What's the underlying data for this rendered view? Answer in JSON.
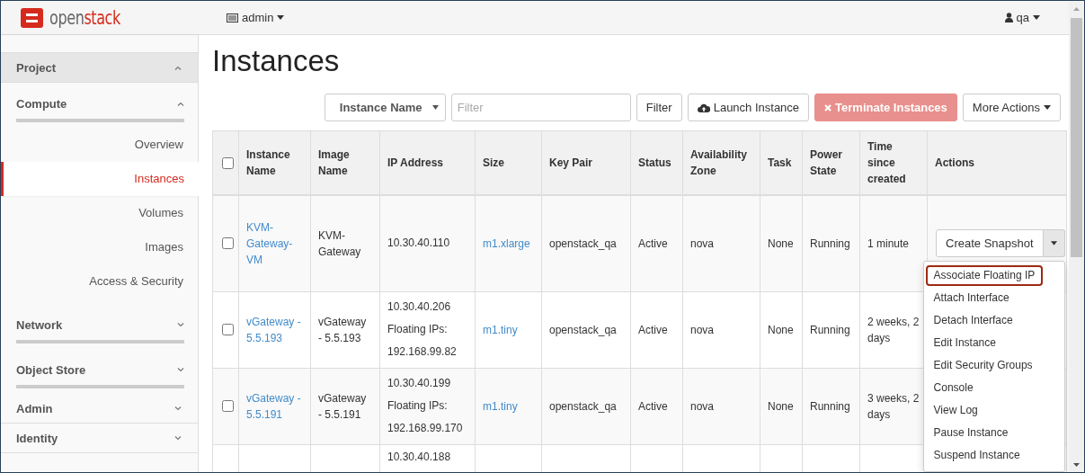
{
  "navbar": {
    "logo_text": [
      "open",
      "stack"
    ],
    "project": "admin",
    "user": "qa"
  },
  "sidebar": {
    "sections": [
      {
        "label": "Project",
        "expanded": true,
        "kind": "dashboard",
        "children": [
          {
            "label": "Compute",
            "expanded": true,
            "kind": "panel",
            "children": [
              {
                "label": "Overview",
                "selected": false
              },
              {
                "label": "Instances",
                "selected": true
              },
              {
                "label": "Volumes",
                "selected": false
              },
              {
                "label": "Images",
                "selected": false
              },
              {
                "label": "Access & Security",
                "selected": false
              }
            ]
          },
          {
            "label": "Network",
            "expanded": false,
            "kind": "panel"
          },
          {
            "label": "Object Store",
            "expanded": false,
            "kind": "panel"
          }
        ]
      },
      {
        "label": "Admin",
        "expanded": false,
        "kind": "dashboard"
      },
      {
        "label": "Identity",
        "expanded": false,
        "kind": "dashboard"
      }
    ]
  },
  "page": {
    "title": "Instances"
  },
  "toolbar": [
    {
      "kind": "select",
      "label": "Instance Name"
    },
    {
      "kind": "input",
      "placeholder": "Filter"
    },
    {
      "kind": "button",
      "label": "Filter"
    },
    {
      "kind": "cloud-button",
      "label": "Launch Instance"
    },
    {
      "kind": "danger-button",
      "label": "Terminate Instances"
    },
    {
      "kind": "dropdown-button",
      "label": "More Actions"
    }
  ],
  "table": {
    "select_all_checked": false,
    "columns": [
      "Instance Name",
      "Image Name",
      "IP Address",
      "Size",
      "Key Pair",
      "Status",
      "Availability Zone",
      "Task",
      "Power State",
      "Time since created",
      "Actions"
    ],
    "rows": [
      {
        "checked": false,
        "instance_name": "KVM-Gateway-VM",
        "image_name": "KVM-Gateway",
        "ip_address": [
          "10.30.40.110"
        ],
        "size": "m1.xlarge",
        "key_pair": "openstack_qa",
        "status": "Active",
        "availability_zone": "nova",
        "task": "None",
        "power_state": "Running",
        "time_since_created": "1 minute",
        "action": {
          "label": "Create Snapshot",
          "menu": [
            {
              "label": "Associate Floating IP",
              "selected": true
            },
            {
              "label": "Attach Interface",
              "selected": false
            },
            {
              "label": "Detach Interface",
              "selected": false
            },
            {
              "label": "Edit Instance",
              "selected": false
            },
            {
              "label": "Edit Security Groups",
              "selected": false
            },
            {
              "label": "Console",
              "selected": false
            },
            {
              "label": "View Log",
              "selected": false
            },
            {
              "label": "Pause Instance",
              "selected": false
            },
            {
              "label": "Suspend Instance",
              "selected": false
            }
          ]
        }
      },
      {
        "checked": false,
        "instance_name": "vGateway - 5.5.193",
        "image_name": "vGateway - 5.5.193",
        "ip_address": [
          "10.30.40.206",
          "Floating IPs:",
          "192.168.99.82"
        ],
        "size": "m1.tiny",
        "key_pair": "openstack_qa",
        "status": "Active",
        "availability_zone": "nova",
        "task": "None",
        "power_state": "Running",
        "time_since_created": "2 weeks, 2 days"
      },
      {
        "checked": false,
        "instance_name": "vGateway - 5.5.191",
        "image_name": "vGateway - 5.5.191",
        "ip_address": [
          "10.30.40.199",
          "Floating IPs:",
          "192.168.99.170"
        ],
        "size": "m1.tiny",
        "key_pair": "openstack_qa",
        "status": "Active",
        "availability_zone": "nova",
        "task": "None",
        "power_state": "Running",
        "time_since_created": "3 weeks, 2 days"
      },
      {
        "ip_address": [
          "10.30.40.188"
        ]
      }
    ]
  }
}
